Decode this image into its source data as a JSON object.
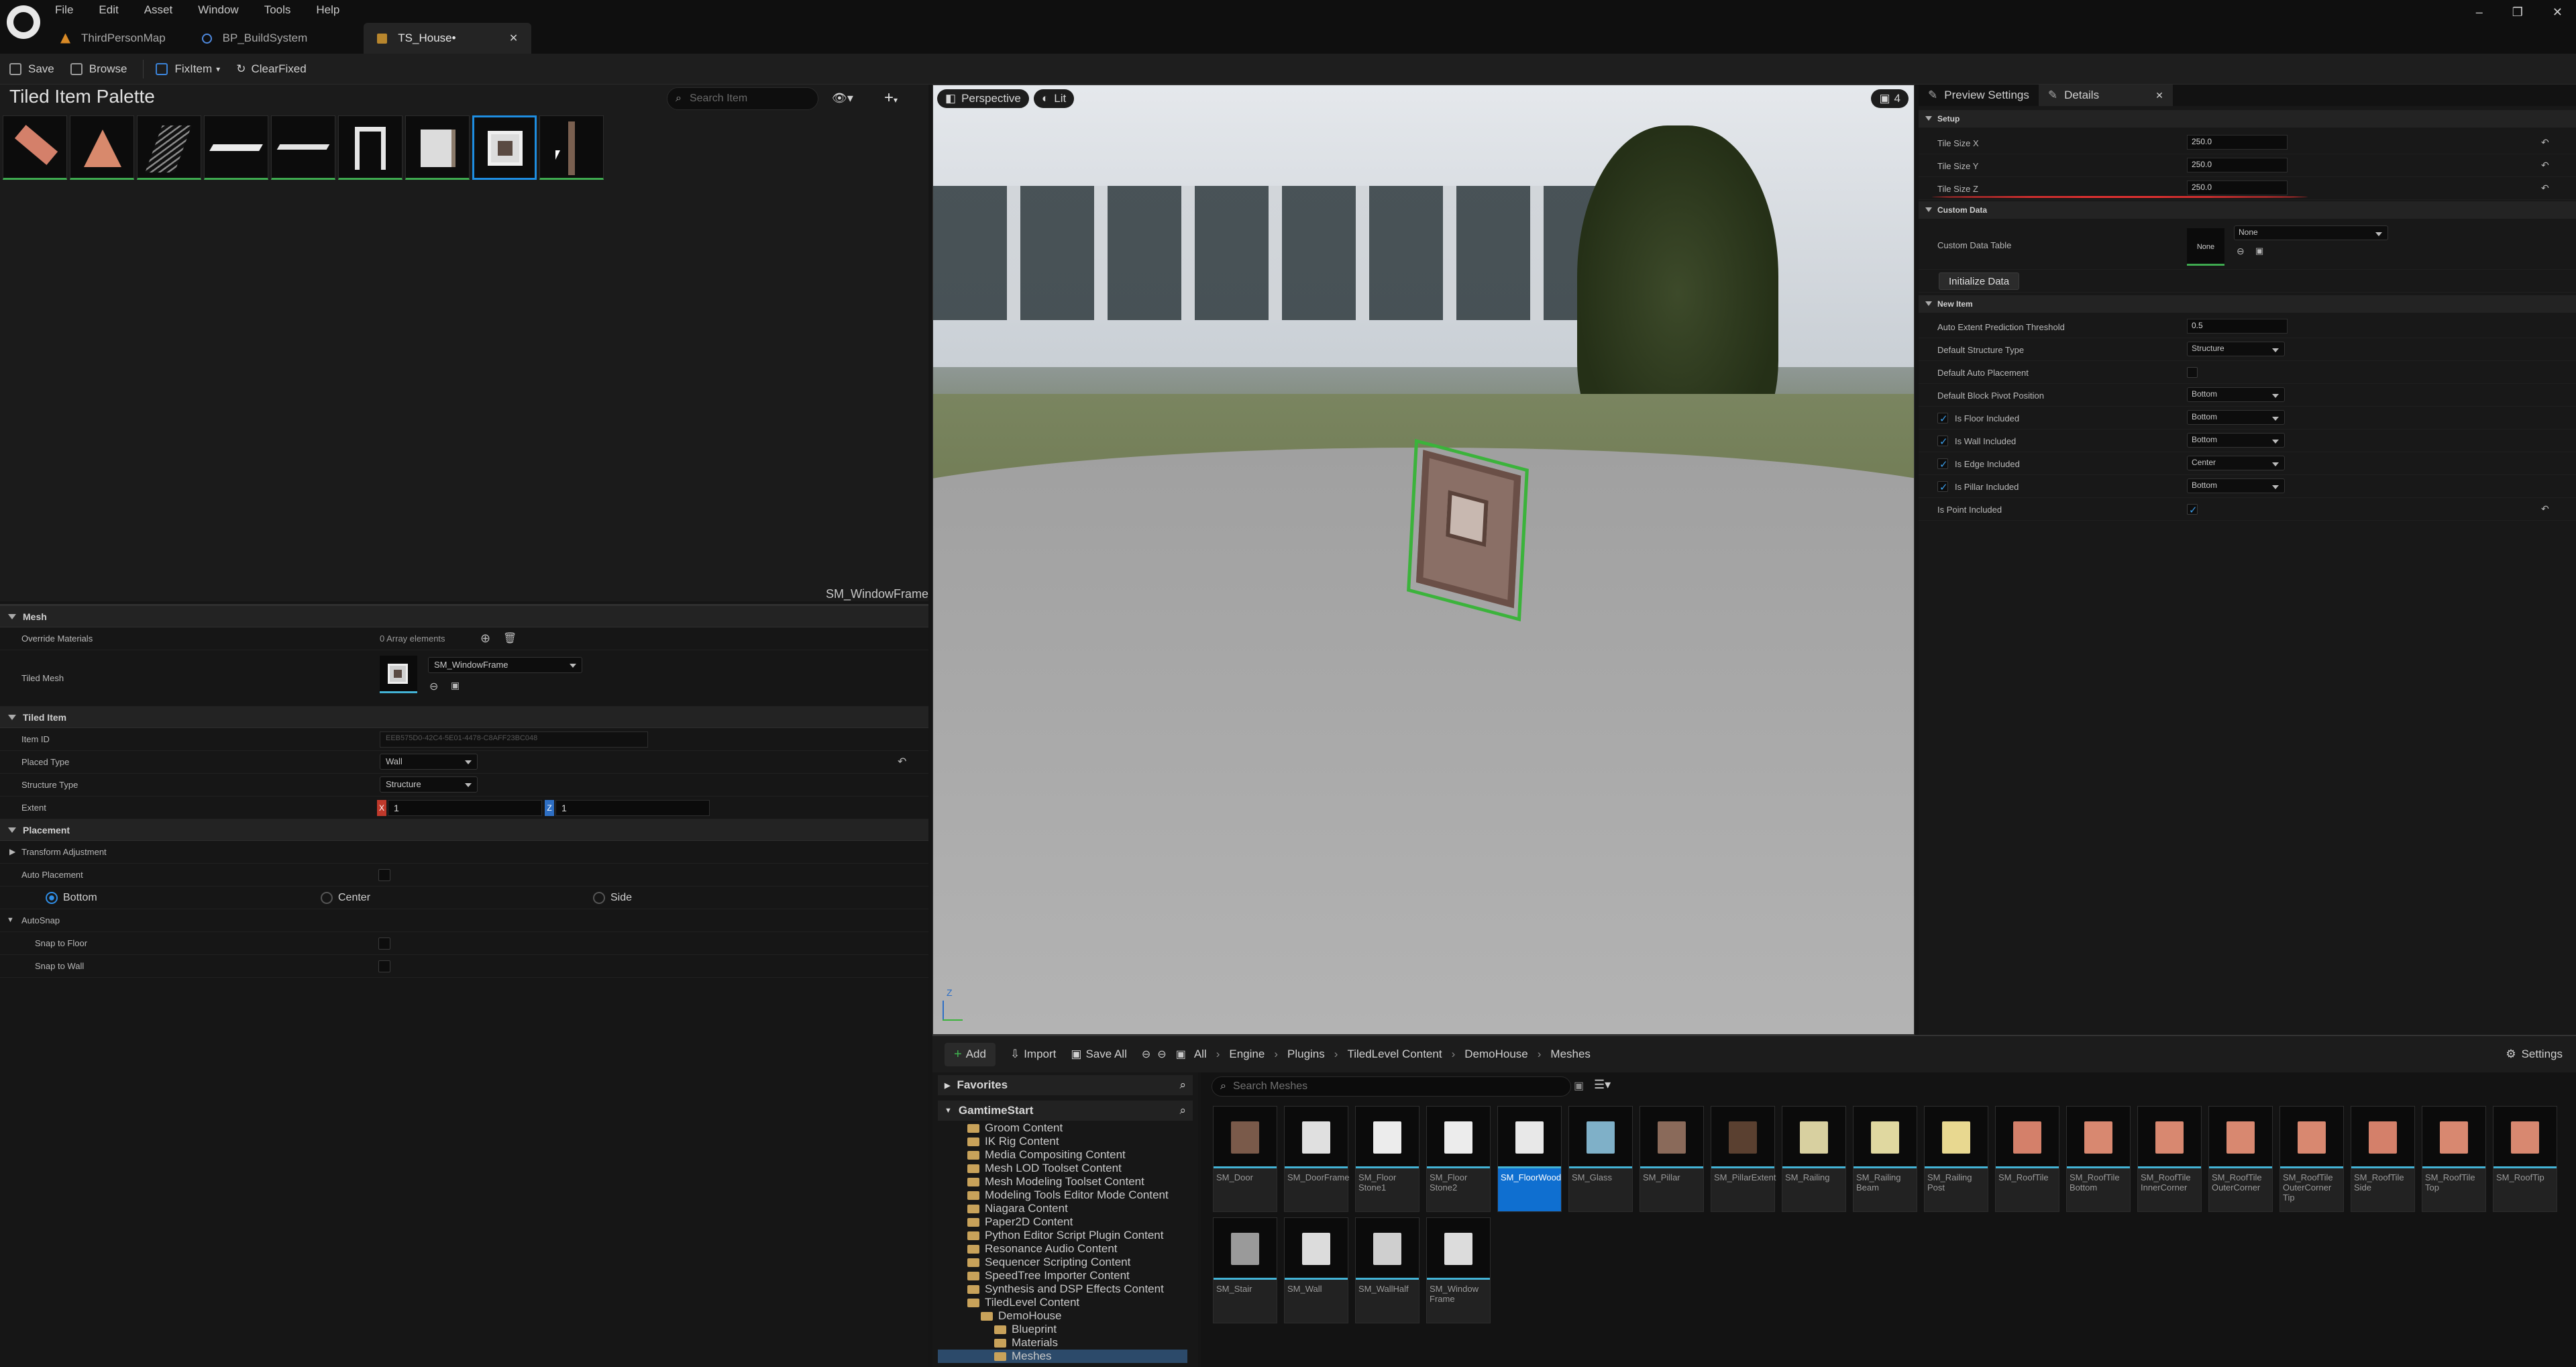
{
  "menu": [
    "File",
    "Edit",
    "Asset",
    "Window",
    "Tools",
    "Help"
  ],
  "tabs": [
    {
      "label": "ThirdPersonMap",
      "active": false
    },
    {
      "label": "BP_BuildSystem",
      "active": false
    },
    {
      "label": "TS_House•",
      "active": true
    }
  ],
  "toolbar": {
    "save": "Save",
    "browse": "Browse",
    "fix_item": "FixItem",
    "clear_fixed": "ClearFixed"
  },
  "palette": {
    "title": "Tiled Item Palette",
    "search_placeholder": "Search Item",
    "selected_label": "SM_WindowFrame"
  },
  "mesh": {
    "category": "Mesh",
    "override_materials_label": "Override Materials",
    "override_materials_value": "0 Array elements",
    "tiled_mesh_label": "Tiled Mesh",
    "tiled_mesh_value": "SM_WindowFrame"
  },
  "tiled_item": {
    "category": "Tiled Item",
    "item_id_label": "Item ID",
    "item_id_value": "EEB575D0-42C4-5E01-4478-C8AFF23BC048",
    "placed_type_label": "Placed Type",
    "placed_type_value": "Wall",
    "structure_type_label": "Structure Type",
    "structure_type_value": "Structure",
    "extent_label": "Extent",
    "extent_x": "1",
    "extent_z": "1",
    "x_axis": "X",
    "z_axis": "Z"
  },
  "placement": {
    "category": "Placement",
    "transform_label": "Transform Adjustment",
    "auto_placement_label": "Auto Placement",
    "options": [
      "Bottom",
      "Center",
      "Side"
    ],
    "selected": "Bottom",
    "autosnap_label": "AutoSnap",
    "snap_floor_label": "Snap to Floor",
    "snap_wall_label": "Snap to Wall"
  },
  "viewport": {
    "perspective": "Perspective",
    "lit": "Lit",
    "camera_speed": "4"
  },
  "details": {
    "tabs": [
      "Preview Settings",
      "Details"
    ],
    "setup": "Setup",
    "tile_size_x_label": "Tile Size X",
    "tile_size_x": "250.0",
    "tile_size_y_label": "Tile Size Y",
    "tile_size_y": "250.0",
    "tile_size_z_label": "Tile Size Z",
    "tile_size_z": "250.0",
    "custom_data": "Custom Data",
    "custom_data_table_label": "Custom Data Table",
    "custom_data_table_thumb": "None",
    "custom_data_table_value": "None",
    "initialize": "Initialize Data",
    "new_item": "New Item",
    "auto_extent_label": "Auto Extent Prediction Threshold",
    "auto_extent_value": "0.5",
    "default_structure_label": "Default Structure Type",
    "default_structure_value": "Structure",
    "default_auto_label": "Default Auto Placement",
    "default_pivot_label": "Default Block Pivot Position",
    "default_pivot_value": "Bottom",
    "floor_label": "Is Floor Included",
    "floor_value": "Bottom",
    "wall_label": "Is Wall Included",
    "wall_value": "Bottom",
    "edge_label": "Is Edge Included",
    "edge_value": "Center",
    "pillar_label": "Is Pillar Included",
    "pillar_value": "Bottom",
    "point_label": "Is Point Included",
    "accent_underline": "#e03030"
  },
  "content_browser": {
    "add": "Add",
    "import": "Import",
    "save_all": "Save All",
    "breadcrumbs": [
      "All",
      "Engine",
      "Plugins",
      "TiledLevel Content",
      "DemoHouse",
      "Meshes"
    ],
    "settings": "Settings",
    "favorites": "Favorites",
    "root": "GamtimeStart",
    "tree": [
      "Groom Content",
      "IK Rig Content",
      "Media Compositing Content",
      "Mesh LOD Toolset Content",
      "Mesh Modeling Toolset Content",
      "Modeling Tools Editor Mode Content",
      "Niagara Content",
      "Paper2D Content",
      "Python Editor Script Plugin Content",
      "Resonance Audio Content",
      "Sequencer Scripting Content",
      "SpeedTree Importer Content",
      "Synthesis and DSP Effects Content",
      "TiledLevel Content",
      "DemoHouse",
      "Blueprint",
      "Materials",
      "Meshes"
    ],
    "search_placeholder": "Search Meshes",
    "assets": [
      [
        "SM_Door"
      ],
      [
        "SM_DoorFrame"
      ],
      [
        "SM_Floor",
        "Stone1"
      ],
      [
        "SM_Floor",
        "Stone2"
      ],
      [
        "SM_FloorWood"
      ],
      [
        "SM_Glass"
      ],
      [
        "SM_Pillar"
      ],
      [
        "SM_PillarExtent"
      ],
      [
        "SM_Railing"
      ],
      [
        "SM_Railing",
        "Beam"
      ],
      [
        "SM_Railing",
        "Post"
      ],
      [
        "SM_RoofTile"
      ],
      [
        "SM_RoofTile",
        "Bottom"
      ],
      [
        "SM_RoofTile",
        "InnerCorner"
      ],
      [
        "SM_RoofTile",
        "OuterCorner"
      ],
      [
        "SM_RoofTile",
        "OuterCorner",
        "Tip"
      ],
      [
        "SM_RoofTile",
        "Side"
      ],
      [
        "SM_RoofTile",
        "Top"
      ],
      [
        "SM_RoofTip"
      ],
      [
        "SM_Stair"
      ],
      [
        "SM_Wall"
      ],
      [
        "SM_WallHalf"
      ],
      [
        "SM_Window",
        "Frame"
      ]
    ]
  }
}
